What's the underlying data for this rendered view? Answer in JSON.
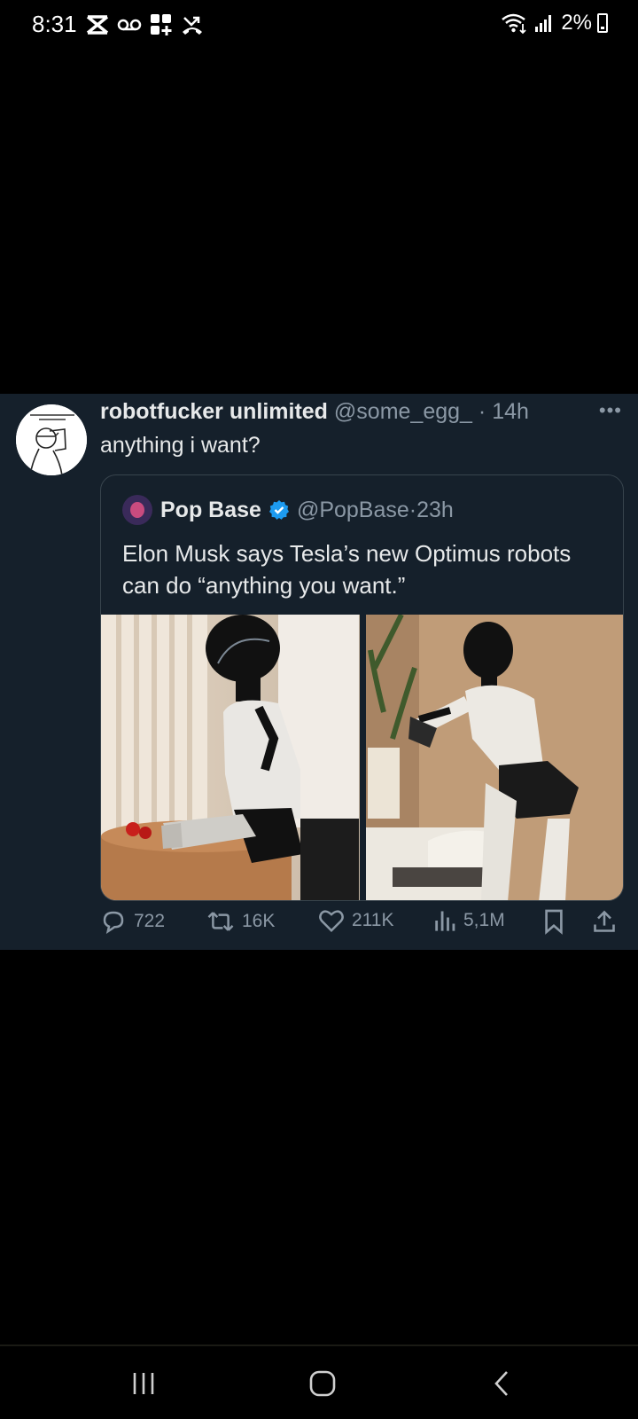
{
  "status_bar": {
    "time": "8:31",
    "battery": "2%",
    "icons": [
      "capcut-icon",
      "voicemail-icon",
      "apps-icon",
      "missed-call-icon",
      "wifi-icon",
      "signal-icon",
      "battery-charging-icon"
    ]
  },
  "tweet": {
    "display_name": "robotfucker unlimited",
    "handle": "@some_egg_",
    "separator": "·",
    "time": "14h",
    "text": "anything i want?",
    "quote": {
      "display_name": "Pop Base",
      "handle": "@PopBase",
      "separator": "·",
      "time": "23h",
      "text": "Elon Musk says Tesla’s new Optimus robots can do “anything you want.”",
      "verified_color": "#1d9bf0"
    },
    "actions": {
      "replies": "722",
      "retweets": "16K",
      "likes": "211K",
      "views": "5,1M"
    }
  },
  "colors": {
    "background": "#000000",
    "card": "#15202b",
    "muted": "#8b98a5"
  }
}
